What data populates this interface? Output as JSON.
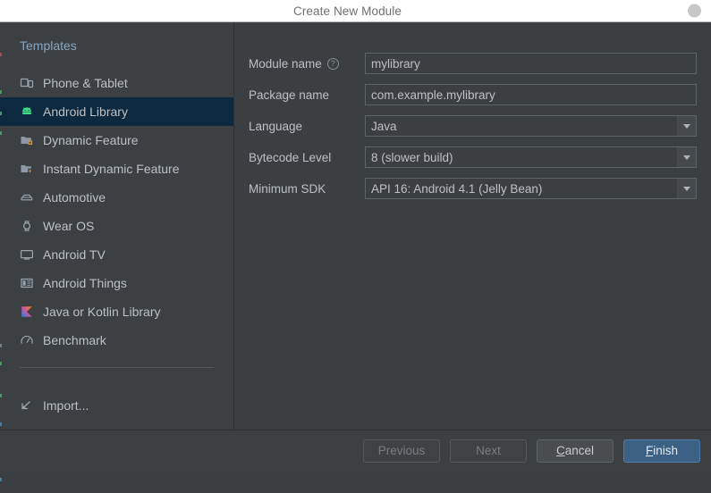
{
  "window": {
    "title": "Create New Module",
    "close_button": "close-circle"
  },
  "sidebar": {
    "header": "Templates",
    "items": [
      {
        "label": "Phone & Tablet",
        "icon": "phone-tablet-icon",
        "selected": false
      },
      {
        "label": "Android Library",
        "icon": "android-robot-icon",
        "selected": true
      },
      {
        "label": "Dynamic Feature",
        "icon": "folder-module-icon",
        "selected": false
      },
      {
        "label": "Instant Dynamic Feature",
        "icon": "folder-instant-icon",
        "selected": false
      },
      {
        "label": "Automotive",
        "icon": "car-icon",
        "selected": false
      },
      {
        "label": "Wear OS",
        "icon": "watch-icon",
        "selected": false
      },
      {
        "label": "Android TV",
        "icon": "tv-icon",
        "selected": false
      },
      {
        "label": "Android Things",
        "icon": "things-board-icon",
        "selected": false
      },
      {
        "label": "Java or Kotlin Library",
        "icon": "kotlin-logo-icon",
        "selected": false
      },
      {
        "label": "Benchmark",
        "icon": "speedometer-icon",
        "selected": false
      }
    ],
    "import": {
      "label": "Import...",
      "icon": "import-arrow-icon"
    }
  },
  "form": {
    "module_name": {
      "label": "Module name",
      "help": "?",
      "value": "mylibrary",
      "placeholder": ""
    },
    "package_name": {
      "label": "Package name",
      "value": "com.example.mylibrary",
      "placeholder": ""
    },
    "language": {
      "label": "Language",
      "value": "Java"
    },
    "bytecode_level": {
      "label": "Bytecode Level",
      "value": "8 (slower build)"
    },
    "minimum_sdk": {
      "label": "Minimum SDK",
      "value": "API 16: Android 4.1 (Jelly Bean)"
    }
  },
  "footer": {
    "previous": "Previous",
    "next": "Next",
    "cancel_mnemonic": "C",
    "cancel_rest": "ancel",
    "finish_mnemonic": "F",
    "finish_rest": "inish"
  },
  "colors": {
    "dialog_bg": "#3c3f41",
    "panel_bg": "#3c4043",
    "selection_bg": "#0d293f",
    "accent_blue": "#3d6185",
    "text": "#bcc0c4",
    "header_text": "#8aa6c0",
    "android_green": "#3ddc84",
    "kotlin_orange": "#f88909"
  }
}
